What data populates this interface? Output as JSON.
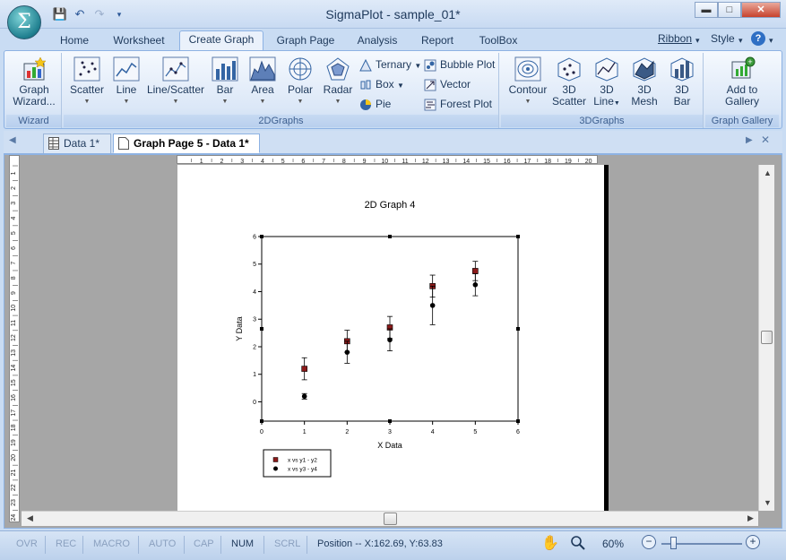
{
  "window": {
    "title": "SigmaPlot - sample_01*",
    "app_orb": "Σ"
  },
  "qat": {
    "icons": [
      "save-icon",
      "undo-icon",
      "redo-icon",
      "customize-icon"
    ]
  },
  "ribbon_tabs": [
    "Home",
    "Worksheet",
    "Create Graph",
    "Graph Page",
    "Analysis",
    "Report",
    "ToolBox"
  ],
  "ribbon_right": {
    "ribbon": "Ribbon",
    "style": "Style"
  },
  "groups": {
    "wizard": {
      "label": "Wizard",
      "button": [
        "Graph",
        "Wizard..."
      ]
    },
    "graphs2d": {
      "label": "2DGraphs",
      "buttons": [
        "Scatter",
        "Line",
        "Line/Scatter",
        "Bar",
        "Area",
        "Polar",
        "Radar"
      ],
      "small": [
        "Ternary",
        "Box",
        "Pie",
        "Bubble Plot",
        "Vector",
        "Forest Plot"
      ]
    },
    "graphs3d": {
      "label": "3DGraphs",
      "buttons": [
        [
          "Contour",
          ""
        ],
        [
          "3D",
          "Scatter"
        ],
        [
          "3D",
          "Line"
        ],
        [
          "3D",
          "Mesh"
        ],
        [
          "3D",
          "Bar"
        ]
      ]
    },
    "gallery": {
      "label": "Graph Gallery",
      "button": [
        "Add to",
        "Gallery"
      ]
    }
  },
  "doc_tabs": [
    {
      "label": "Data 1*",
      "active": false
    },
    {
      "label": "Graph Page 5 - Data 1*",
      "active": true
    }
  ],
  "ruler_h_labels": [
    "1",
    "2",
    "3",
    "4",
    "5",
    "6",
    "7",
    "8",
    "9",
    "10",
    "11",
    "12",
    "13",
    "14",
    "15",
    "16",
    "17",
    "18",
    "19",
    "20"
  ],
  "ruler_v_labels": [
    "1",
    "2",
    "3",
    "4",
    "5",
    "6",
    "7",
    "8",
    "9",
    "10",
    "11",
    "12",
    "13",
    "14",
    "15",
    "16",
    "17",
    "18",
    "19",
    "20",
    "21",
    "22",
    "23",
    "24"
  ],
  "chart_data": {
    "type": "scatter",
    "title": "2D Graph 4",
    "xlabel": "X Data",
    "ylabel": "Y Data",
    "xlim": [
      0,
      6
    ],
    "ylim": [
      -0.7,
      6
    ],
    "xticks": [
      0,
      1,
      2,
      3,
      4,
      5,
      6
    ],
    "yticks": [
      0,
      1,
      2,
      3,
      4,
      5,
      6
    ],
    "grid": false,
    "legend_position": "bottom-left, below plot",
    "series": [
      {
        "name": "x vs y1 - y2",
        "marker": "square",
        "color": "#8b1a1a",
        "x": [
          1,
          2,
          3,
          4,
          5
        ],
        "y": [
          1.2,
          2.2,
          2.7,
          4.2,
          4.75
        ],
        "err": [
          0.4,
          0.4,
          0.4,
          0.4,
          0.35
        ]
      },
      {
        "name": "x vs y3 - y4",
        "marker": "circle",
        "color": "#000000",
        "x": [
          1,
          2,
          3,
          4,
          5
        ],
        "y": [
          0.2,
          1.8,
          2.25,
          3.5,
          4.25
        ],
        "err": [
          0.1,
          0.4,
          0.4,
          0.7,
          0.4
        ]
      }
    ]
  },
  "status": {
    "items": [
      {
        "label": "OVR",
        "on": false
      },
      {
        "label": "REC",
        "on": false
      },
      {
        "label": "MACRO",
        "on": false
      },
      {
        "label": "AUTO",
        "on": false
      },
      {
        "label": "CAP",
        "on": false
      },
      {
        "label": "NUM",
        "on": true
      },
      {
        "label": "SCRL",
        "on": false
      }
    ],
    "position": "Position -- X:162.69, Y:63.83",
    "zoom": "60%"
  },
  "colors": {
    "accent": "#1e395b",
    "ribbon_border": "#8db2e3",
    "workspace": "#a6a6a6"
  }
}
